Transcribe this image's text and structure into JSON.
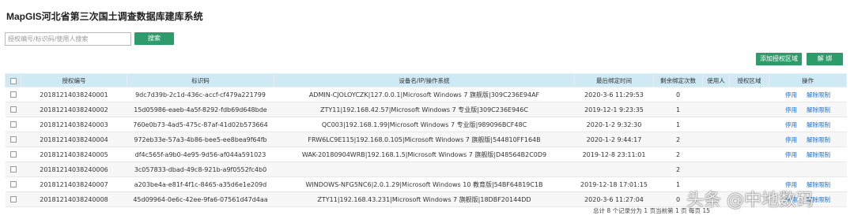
{
  "header": {
    "title": "MapGIS河北省第三次国土调查数据库建库系统"
  },
  "search": {
    "placeholder": "授权编号/标识码/使用人搜索",
    "value": "",
    "button_label": "搜索"
  },
  "toolbar": {
    "add_label": "添加授权区域",
    "unbind_label": "解 绑"
  },
  "table": {
    "columns": [
      "授权编号",
      "标识码",
      "设备名/IP/操作系统",
      "最后绑定时间",
      "剩余绑定次数",
      "使用人",
      "授权区域",
      "操作"
    ],
    "rows": [
      {
        "id": "20181214038240001",
        "code": "9dc7d39b-2c1d-436c-accf-cf479a221799",
        "device": "ADMIN-CJOLOYCZK|127.0.0.1|Microsoft Windows 7 旗舰版|309C236E94AF",
        "time": "2020-3-6 11:29:53",
        "remaining": "0",
        "user": "",
        "region": "",
        "has_actions": true
      },
      {
        "id": "20181214038240002",
        "code": "15d05986-eaeb-4a5f-8292-fdb69d648bde",
        "device": "ZTY11|192.168.42.57|Microsoft Windows 7 专业版|309C236E946C",
        "time": "2019-12-1 9:23:35",
        "remaining": "1",
        "user": "",
        "region": "",
        "has_actions": true
      },
      {
        "id": "20181214038240003",
        "code": "760e0b73-4ad5-475c-87af-41d02b573664",
        "device": "QC003|192.168.1.99|Microsoft Windows 7 专业版|989096BCF48C",
        "time": "2020-1-2 9:32:30",
        "remaining": "1",
        "user": "",
        "region": "",
        "has_actions": true
      },
      {
        "id": "20181214038240004",
        "code": "972eb33e-57a3-4b86-bee5-ee8bea9f64fb",
        "device": "FRW6LC9E115|192.168.0.105|Microsoft Windows 7 旗舰版|544810FF164B",
        "time": "2020-1-2 9:44:17",
        "remaining": "2",
        "user": "",
        "region": "",
        "has_actions": true
      },
      {
        "id": "20181214038240005",
        "code": "df4c565f-a9b0-4e95-9d56-af044a591023",
        "device": "WAK-20180904WRB|192.168.1.5|Microsoft Windows 7 旗舰版|D48564B2C0D9",
        "time": "2019-12-8 23:11:01",
        "remaining": "2",
        "user": "",
        "region": "",
        "has_actions": true
      },
      {
        "id": "20181214038240006",
        "code": "3c057833-dbad-49c8-921b-a9f0552fc4b0",
        "device": "",
        "time": "",
        "remaining": "2",
        "user": "",
        "region": "",
        "has_actions": false
      },
      {
        "id": "20181214038240007",
        "code": "a203be4a-e81f-4f1c-8465-a35d6e1e209d",
        "device": "WINDOWS-NFG5NC6|2.0.1.29|Microsoft Windows 10 教育版|54BF64819C1B",
        "time": "2019-12-18 17:01:15",
        "remaining": "1",
        "user": "",
        "region": "",
        "has_actions": true
      },
      {
        "id": "20181214038240008",
        "code": "45d09964-0e6c-42ee-9fa6-07561d47d4aa",
        "device": "ZTY11|192.168.43.231|Microsoft Windows 7 旗舰版|18DBF20144DD",
        "time": "2020-3-6 11:27:04",
        "remaining": "0",
        "user": "",
        "region": "",
        "has_actions": true
      }
    ],
    "action_labels": {
      "disable": "停用",
      "unbind_limit": "解除限制"
    }
  },
  "pager": {
    "text": "总计 8 个记录分为 1 页当前第 1 页 每页 15"
  },
  "watermark": {
    "text": "头条 @中地数码"
  }
}
